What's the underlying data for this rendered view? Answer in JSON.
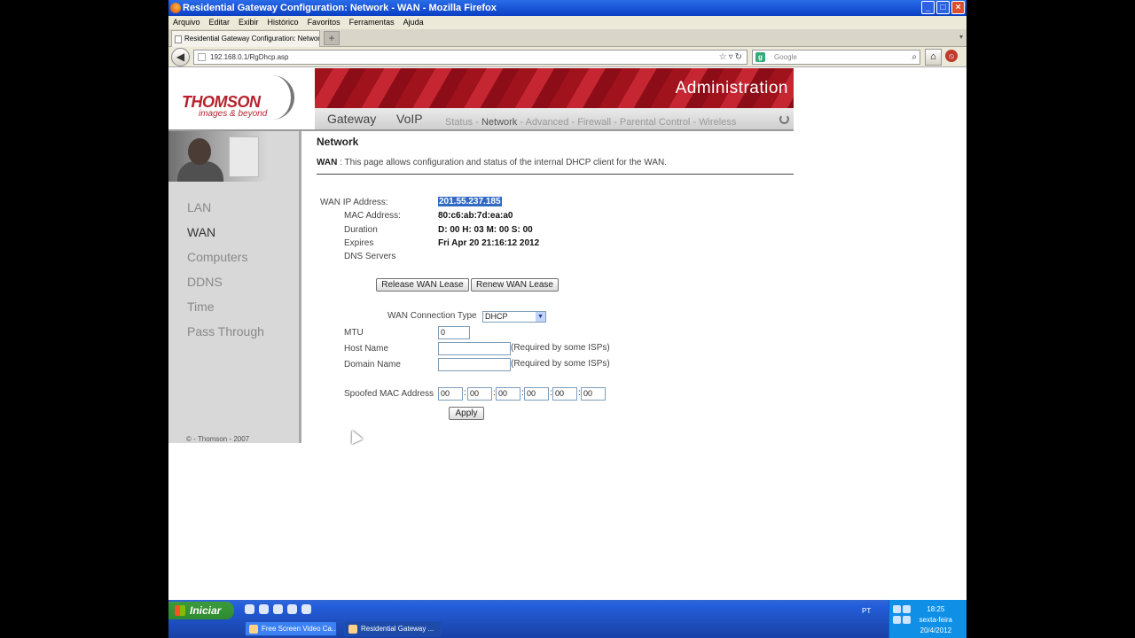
{
  "window": {
    "title": "Residential Gateway Configuration: Network - WAN - Mozilla Firefox"
  },
  "menu": [
    "Arquivo",
    "Editar",
    "Exibir",
    "Histórico",
    "Favoritos",
    "Ferramentas",
    "Ajuda"
  ],
  "tab": {
    "label": "Residential Gateway Configuration: Network..."
  },
  "nav": {
    "url": "192.168.0.1/RgDhcp.asp",
    "search_placeholder": "Google"
  },
  "router": {
    "brand": "THOMSON",
    "tagline": "images & beyond",
    "header_title": "Administration",
    "main_tabs": [
      "Gateway",
      "VoIP"
    ],
    "subnav": [
      {
        "label": "Status",
        "active": false
      },
      {
        "label": "Network",
        "active": true
      },
      {
        "label": "Advanced",
        "active": false
      },
      {
        "label": "Firewall",
        "active": false
      },
      {
        "label": "Parental Control",
        "active": false
      },
      {
        "label": "Wireless",
        "active": false
      }
    ],
    "sidebar": [
      "LAN",
      "WAN",
      "Computers",
      "DDNS",
      "Time",
      "Pass Through"
    ],
    "sidebar_active": "WAN",
    "copyright": "© - Thomson - 2007"
  },
  "content": {
    "heading": "Network",
    "section": "WAN",
    "description": " : This page allows configuration and status of the internal DHCP client for the WAN.",
    "fields": {
      "wan_ip_label": "WAN IP Address:",
      "wan_ip_value": "201.55.237.185",
      "mac_label": "MAC Address:",
      "mac_value": "80:c6:ab:7d:ea:a0",
      "duration_label": "Duration",
      "duration_value": "D: 00 H: 03 M: 00 S: 00",
      "expires_label": "Expires",
      "expires_value": "Fri Apr 20 21:16:12 2012",
      "dns_label": "DNS Servers"
    },
    "buttons": {
      "release": "Release WAN Lease",
      "renew": "Renew WAN Lease",
      "apply": "Apply"
    },
    "form": {
      "connection_type_label": "WAN Connection Type",
      "connection_type_value": "DHCP",
      "mtu_label": "MTU",
      "mtu_value": "0",
      "host_name_label": "Host Name",
      "host_name_value": "",
      "domain_name_label": "Domain Name",
      "domain_name_value": "",
      "required_note": "(Required by some ISPs)",
      "spoofed_mac_label": "Spoofed MAC Address",
      "spoofed_mac_values": [
        "00",
        "00",
        "00",
        "00",
        "00",
        "00"
      ]
    }
  },
  "taskbar": {
    "start": "Iniciar",
    "items": [
      {
        "label": "Free Screen Video Ca...",
        "active": false
      },
      {
        "label": "Residential Gateway ...",
        "active": true
      }
    ],
    "lang": "PT",
    "time": "18:25",
    "weekday": "sexta-feira",
    "date": "20/4/2012"
  },
  "colors": {
    "brand_red": "#b7222e",
    "selection_blue": "#316ac5"
  }
}
